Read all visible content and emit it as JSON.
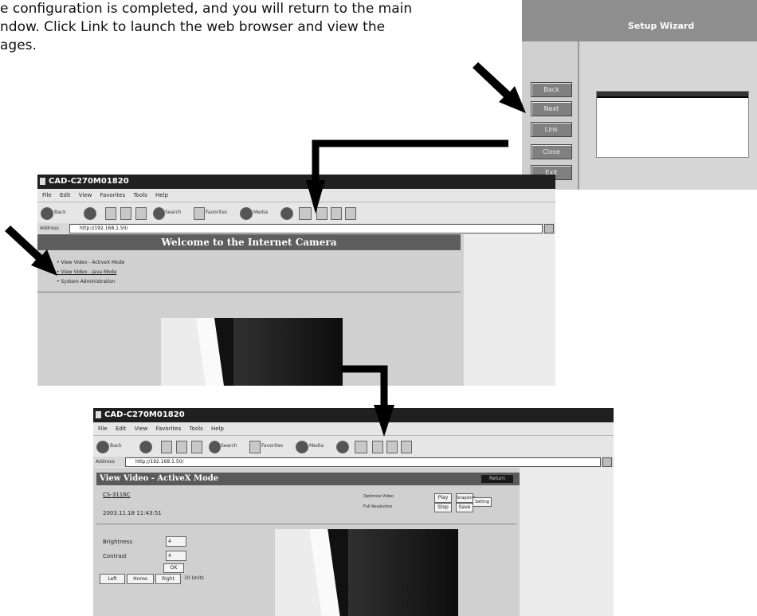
{
  "intro": {
    "line1": "e configuration is completed, and you will return to the main",
    "line2": "ndow.  Click Link to launch the web browser and view the",
    "line3": "ages."
  },
  "wizard": {
    "title": "Setup Wizard",
    "buttons": [
      "Back",
      "Next",
      "Link",
      "Close",
      "Exit"
    ]
  },
  "browser1": {
    "title": "CAD-C270M01820",
    "menu": [
      "File",
      "Edit",
      "View",
      "Favorites",
      "Tools",
      "Help"
    ],
    "toolbar": {
      "back": "Back",
      "search": "Search",
      "favorites": "Favorites",
      "media": "Media"
    },
    "address_label": "Address",
    "address": "http://192.168.1.50/",
    "page": {
      "heading": "Welcome to the Internet Camera",
      "links": [
        "View Video - ActiveX Mode",
        "View Video - Java Mode",
        "System Administration"
      ]
    }
  },
  "browser2": {
    "title": "CAD-C270M01820",
    "menu": [
      "File",
      "Edit",
      "View",
      "Favorites",
      "Tools",
      "Help"
    ],
    "toolbar": {
      "back": "Back",
      "search": "Search",
      "favorites": "Favorites",
      "media": "Media"
    },
    "address_label": "Address",
    "address": "http://192.168.1.50/",
    "page": {
      "heading": "View Video - ActiveX Mode",
      "return_label": "Return",
      "camera_name": "CS-3116C",
      "datetime": "2003.11.18 11:43:51",
      "options": [
        "Optimize Video",
        "Full Resolution"
      ],
      "play": "Play",
      "stop": "Stop",
      "snapshot": "Snapshot",
      "save": "Save",
      "setting": "Setting",
      "brightness_label": "Brightness",
      "brightness_value": "4",
      "contrast_label": "Contrast",
      "contrast_value": "4",
      "ok": "OK",
      "pan_left": "Left",
      "pan_home": "Home",
      "pan_right": "Right",
      "pan_step": "10 Units"
    }
  }
}
